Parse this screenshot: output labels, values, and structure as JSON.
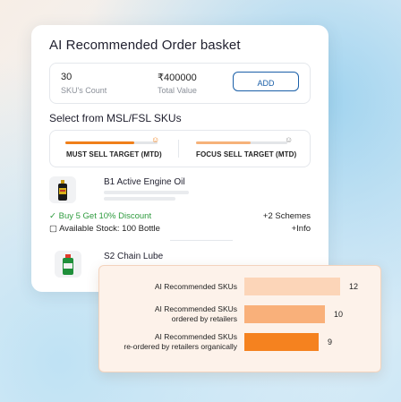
{
  "card": {
    "title": "AI Recommended Order basket",
    "summary": {
      "count_value": "30",
      "count_label": "SKU's Count",
      "total_value": "₹400000",
      "total_label": "Total Value",
      "add_label": "ADD"
    },
    "section_title": "Select from MSL/FSL SKUs",
    "targets": {
      "must": {
        "label": "MUST SELL TARGET (MTD)",
        "progress": 0.75,
        "color": "#f07f1a"
      },
      "focus": {
        "label": "FOCUS SELL TARGET (MTD)",
        "progress": 0.6,
        "color": "#f6b27a"
      }
    },
    "products": [
      {
        "name": "B1 Active Engine Oil",
        "offer": "Buy 5 Get 10% Discount",
        "stock": "Available Stock: 100 Bottle",
        "schemes": "+2 Schemes",
        "info": "+Info"
      },
      {
        "name": "S2 Chain Lube"
      }
    ]
  },
  "overlay": {
    "rows": [
      {
        "label": "AI Recommended SKUs",
        "value": "12",
        "ratio": 1.0,
        "color": "#fcd5b8"
      },
      {
        "label": "AI Recommended SKUs\nordered by retailers",
        "value": "10",
        "ratio": 0.84,
        "color": "#f9b07a"
      },
      {
        "label": "AI Recommended SKUs\nre-ordered by retailers organically",
        "value": "9",
        "ratio": 0.78,
        "color": "#f5821f"
      }
    ]
  },
  "colors": {
    "accent": "#1a5fa8",
    "offer_green": "#2e9b3e",
    "orange": "#f07f1a"
  }
}
